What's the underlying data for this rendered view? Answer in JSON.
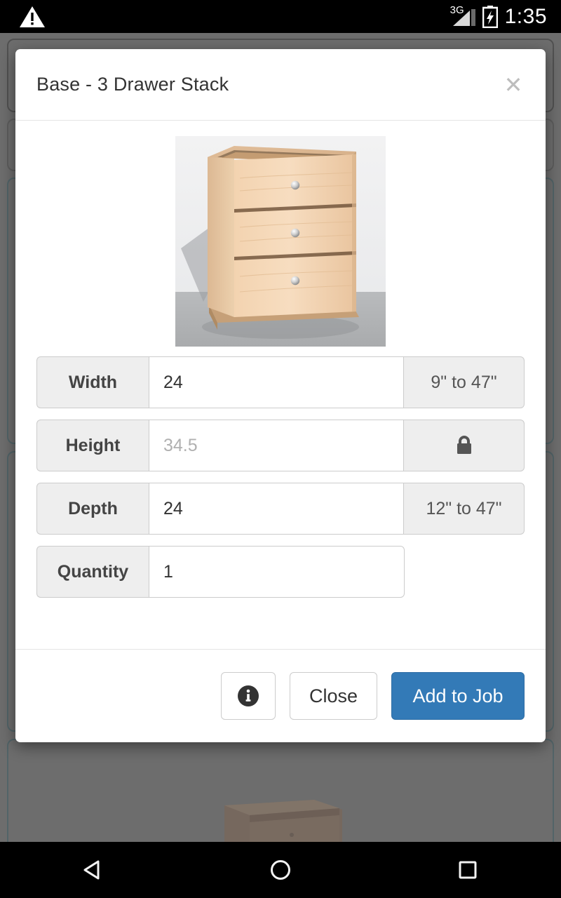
{
  "status_bar": {
    "warning_icon": "warning-triangle-icon",
    "network_label": "3G",
    "signal_icon": "signal-bars-icon",
    "battery_icon": "battery-charging-icon",
    "time": "1:35"
  },
  "dialog": {
    "title": "Base - 3 Drawer Stack",
    "close_icon": "✕",
    "product_image_alt": "base-3-drawer-stack-cabinet-render",
    "fields": [
      {
        "label": "Width",
        "value": "24",
        "placeholder": "Width",
        "suffix": "9\" to 47\"",
        "disabled": false,
        "suffix_icon": null
      },
      {
        "label": "Height",
        "value": "34.5",
        "placeholder": "Height",
        "suffix": "",
        "disabled": true,
        "suffix_icon": "lock-icon"
      },
      {
        "label": "Depth",
        "value": "24",
        "placeholder": "Depth",
        "suffix": "12\" to 47\"",
        "disabled": false,
        "suffix_icon": null
      },
      {
        "label": "Quantity",
        "value": "1",
        "placeholder": "Quantity",
        "suffix": null,
        "disabled": false,
        "suffix_icon": null
      }
    ],
    "footer": {
      "info_label": "",
      "info_icon": "info-circle-icon",
      "close_label": "Close",
      "add_label": "Add to Job"
    }
  },
  "nav_bar": {
    "back_icon": "back-triangle-icon",
    "home_icon": "home-circle-icon",
    "recents_icon": "recents-square-icon"
  },
  "colors": {
    "primary": "#337ab7",
    "primary_border": "#2e6da4",
    "addon_bg": "#eeeeee",
    "border": "#cccccc",
    "backdrop": "#8a8a8a",
    "card_border": "#5c7b82",
    "text": "#333333",
    "muted_text": "#b0b0b0"
  }
}
